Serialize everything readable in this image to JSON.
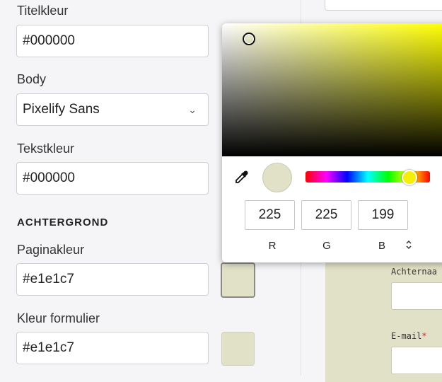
{
  "settings": {
    "titelkleur_label": "Titelkleur",
    "titelkleur_value": "#000000",
    "body_label": "Body",
    "body_font": "Pixelify Sans",
    "tekstkleur_label": "Tekstkleur",
    "tekstkleur_value": "#000000",
    "achtergrond_heading": "ACHTERGROND",
    "paginakleur_label": "Paginakleur",
    "paginakleur_value": "#e1e1c7",
    "formulier_label": "Kleur formulier",
    "formulier_value": "#e1e1c7"
  },
  "picker": {
    "r": "225",
    "g": "225",
    "b": "199",
    "r_label": "R",
    "g_label": "G",
    "b_label": "B",
    "mode_toggle": "⌃⌄"
  },
  "preview": {
    "achternaam_label": "Achternaa",
    "email_label": "E-mail",
    "required_mark": "*"
  },
  "colors": {
    "page_background": "#e1e1c7",
    "form_background": "#e1e1c7",
    "hue": "#ffff00"
  }
}
